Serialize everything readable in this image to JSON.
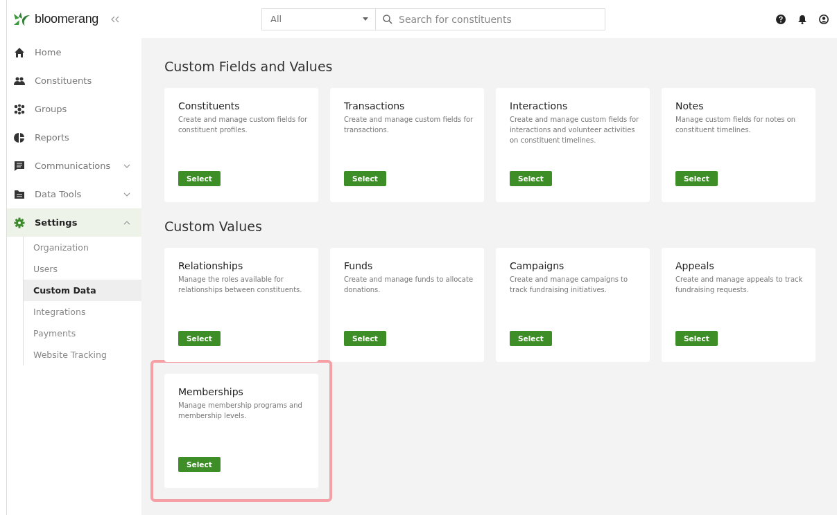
{
  "brand": {
    "name": "bloomerang"
  },
  "search": {
    "scope": "All",
    "placeholder": "Search for constituents"
  },
  "sidebar": {
    "items": [
      {
        "label": "Home",
        "selected": false
      },
      {
        "label": "Constituents",
        "selected": false
      },
      {
        "label": "Groups",
        "selected": false
      },
      {
        "label": "Reports",
        "selected": false
      },
      {
        "label": "Communications",
        "selected": false,
        "expanded": false
      },
      {
        "label": "Data Tools",
        "selected": false,
        "expanded": false
      },
      {
        "label": "Settings",
        "selected": true,
        "expanded": true,
        "children": [
          {
            "label": "Organization",
            "selected": false
          },
          {
            "label": "Users",
            "selected": false
          },
          {
            "label": "Custom Data",
            "selected": true
          },
          {
            "label": "Integrations",
            "selected": false
          },
          {
            "label": "Payments",
            "selected": false
          },
          {
            "label": "Website Tracking",
            "selected": false
          }
        ]
      }
    ]
  },
  "sections": [
    {
      "title": "Custom Fields and Values",
      "cards": [
        {
          "title": "Constituents",
          "description": "Create and manage custom fields for constituent profiles.",
          "button": "Select",
          "highlighted": false
        },
        {
          "title": "Transactions",
          "description": "Create and manage custom fields for transactions.",
          "button": "Select",
          "highlighted": false
        },
        {
          "title": "Interactions",
          "description": "Create and manage custom fields for interactions and volunteer activities on constituent timelines.",
          "button": "Select",
          "highlighted": false
        },
        {
          "title": "Notes",
          "description": "Manage custom fields for notes on constituent timelines.",
          "button": "Select",
          "highlighted": false
        }
      ]
    },
    {
      "title": "Custom Values",
      "cards": [
        {
          "title": "Relationships",
          "description": "Manage the roles available for relationships between constituents.",
          "button": "Select",
          "highlighted": false
        },
        {
          "title": "Funds",
          "description": "Create and manage funds to allocate donations.",
          "button": "Select",
          "highlighted": false
        },
        {
          "title": "Campaigns",
          "description": "Create and manage campaigns to track fundraising initiatives.",
          "button": "Select",
          "highlighted": false
        },
        {
          "title": "Appeals",
          "description": "Create and manage appeals to track fundraising requests.",
          "button": "Select",
          "highlighted": false
        },
        {
          "title": "Memberships",
          "description": "Manage membership programs and membership levels.",
          "button": "Select",
          "highlighted": true
        }
      ]
    }
  ]
}
